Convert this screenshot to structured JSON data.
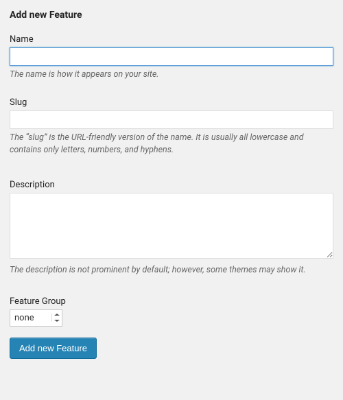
{
  "page_title": "Add new Feature",
  "fields": {
    "name": {
      "label": "Name",
      "value": "",
      "help": "The name is how it appears on your site."
    },
    "slug": {
      "label": "Slug",
      "value": "",
      "help": "The “slug” is the URL-friendly version of the name. It is usually all lowercase and contains only letters, numbers, and hyphens."
    },
    "description": {
      "label": "Description",
      "value": "",
      "help": "The description is not prominent by default; however, some themes may show it."
    },
    "feature_group": {
      "label": "Feature Group",
      "selected": "none"
    }
  },
  "submit_label": "Add new Feature"
}
